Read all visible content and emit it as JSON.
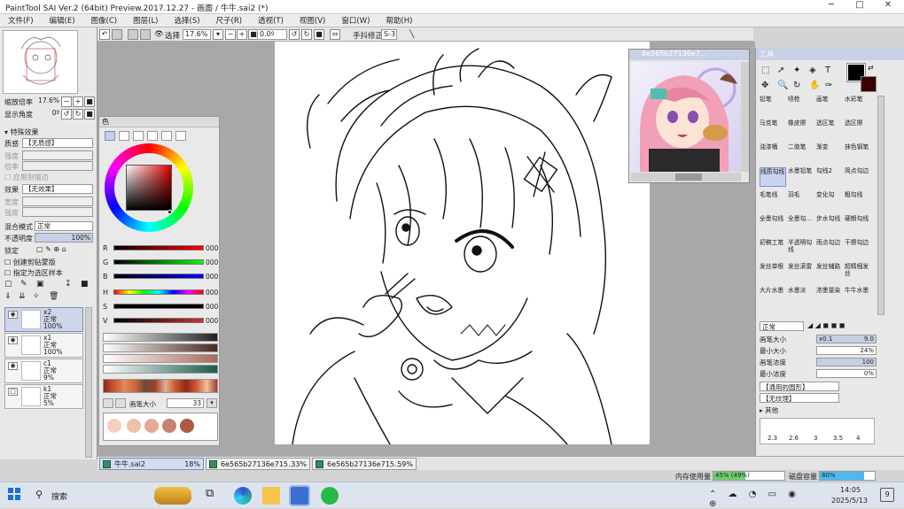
{
  "window": {
    "title": "PaintTool SAI Ver.2 (64bit) Preview.2017.12.27 - 画面 / 牛牛.sai2 (*)",
    "controls": [
      "─",
      "□",
      "✕"
    ]
  },
  "menu": [
    "文件(F)",
    "编辑(E)",
    "图像(C)",
    "图层(L)",
    "选择(S)",
    "尺子(R)",
    "透视(T)",
    "视图(V)",
    "窗口(W)",
    "帮助(H)"
  ],
  "toolbar": {
    "select_label": "选择",
    "zoom": "17.6%",
    "angle": "0.0º",
    "stabilizer_label": "手抖修正",
    "stabilizer_value": "S-3"
  },
  "left": {
    "zoom_label": "缩放倍率",
    "zoom_value": "17.6%",
    "angle_label": "显示角度",
    "angle_value": "0º",
    "effects_header": "特殊效果",
    "texture_label": "质感",
    "texture_value": "【无质感】",
    "scale_label": "强度",
    "strength_label": "倍率",
    "apply_rows_label": "应用到描边",
    "effect_label": "效果",
    "effect_value": "【无效果】",
    "width_label": "宽度",
    "strength2_label": "强度",
    "blend_label": "混合模式",
    "blend_value": "正常",
    "opacity_label": "不透明度",
    "opacity_value": "100%",
    "lock_label": "锁定",
    "clip_label": "创建剪贴蒙版",
    "sample_label": "指定为选区样本",
    "layers": [
      {
        "name": "x2",
        "mode": "正常",
        "opacity": "100%",
        "selected": true
      },
      {
        "name": "x1",
        "mode": "正常",
        "opacity": "100%",
        "selected": false
      },
      {
        "name": "c1",
        "mode": "正常",
        "opacity": "9%",
        "selected": false
      },
      {
        "name": "k1",
        "mode": "正常",
        "opacity": "5%",
        "selected": false
      }
    ]
  },
  "color": {
    "header": "色",
    "sliders": [
      {
        "name": "R",
        "value": "000"
      },
      {
        "name": "G",
        "value": "000"
      },
      {
        "name": "B",
        "value": "000"
      },
      {
        "name": "H",
        "value": "000"
      },
      {
        "name": "S",
        "value": "000"
      },
      {
        "name": "V",
        "value": "000"
      }
    ],
    "brush_size_label": "画笔大小",
    "brush_size_value": "33"
  },
  "navigator": {
    "title": "6e565b27136e7…"
  },
  "tools": {
    "header": "工具",
    "rows": [
      [
        "铅笔",
        "喷枪",
        "画笔",
        "水彩笔"
      ],
      [
        "马克笔",
        "橡皮擦",
        "选区笔",
        "选区擦"
      ],
      [
        "油漆桶",
        "二值笔",
        "渐变",
        "抹色钢笔"
      ],
      [
        "线质勾线",
        "水墨铅笔",
        "勾线2",
        "简点勾边"
      ],
      [
        "毛笔线",
        "羽毛",
        "变化勾",
        "粗勾线"
      ],
      [
        "全墨勾线",
        "全墨勾…",
        "步水勾线",
        "硬朗勾线"
      ],
      [
        "初稿工笔",
        "半透明勾线",
        "雨点勾边",
        "干擦勾边"
      ],
      [
        "发丝单根",
        "发丝滚雷",
        "发丝辅路",
        "超精细发丝"
      ],
      [
        "大片水墨",
        "水墨淡",
        "浓墨量染",
        "牛牛水墨"
      ]
    ],
    "mode_value": "正常",
    "brush_size_label": "画笔大小",
    "brush_size_mult": "x0.1",
    "brush_size_value": "9.0",
    "min_size_label": "最小大小",
    "min_size_value": "24%",
    "density_label": "画笔浓度",
    "density_value": "100",
    "min_density_label": "最小浓度",
    "min_density_value": "0%",
    "shape_value": "【通用的圆形】",
    "texture_value": "【无纹理】",
    "other_label": "其他",
    "size_presets": [
      "2.3",
      "2.6",
      "3",
      "3.5",
      "4"
    ]
  },
  "status": {
    "tabs": [
      {
        "name": "牛牛.sai2",
        "pct": "18%",
        "active": true
      },
      {
        "name": "6e565b27136e715…",
        "pct": "33%",
        "active": false
      },
      {
        "name": "6e565b27136e715…",
        "pct": "59%",
        "active": false
      }
    ],
    "memory_label": "内存使用量",
    "memory_value": "45% (49%)",
    "disk_label": "磁盘容量",
    "disk_value": "80%"
  },
  "taskbar": {
    "search_placeholder": "搜索",
    "time": "14:05",
    "date": "2025/5/13",
    "notif_count": "9"
  }
}
